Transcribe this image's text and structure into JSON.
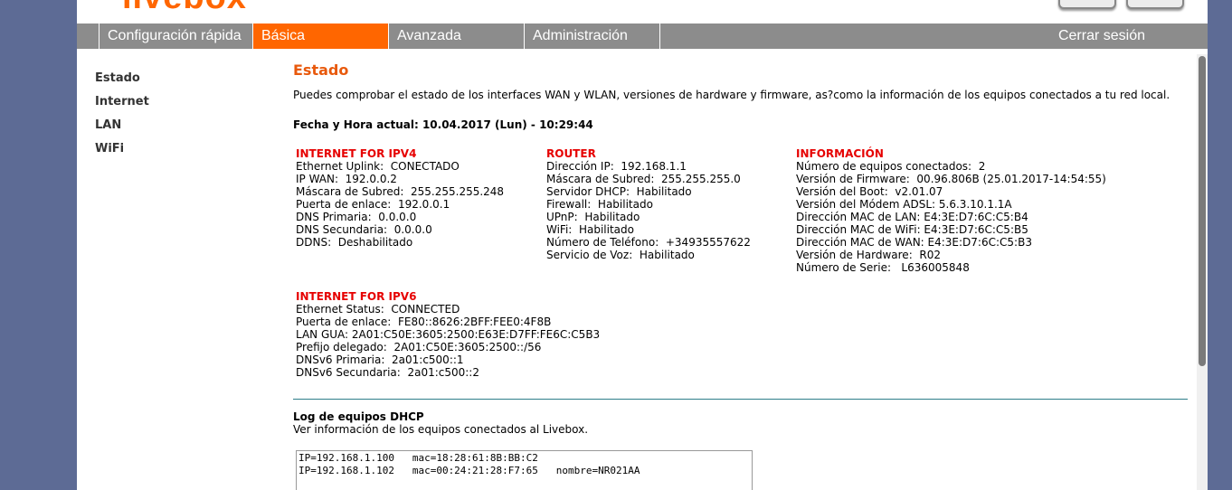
{
  "header": {
    "logo": "livebox"
  },
  "nav": {
    "tabs": [
      {
        "label": "Configuración rápida"
      },
      {
        "label": "Básica"
      },
      {
        "label": "Avanzada"
      },
      {
        "label": "Administración"
      }
    ],
    "active_tab": "Básica",
    "logout_label": "Cerrar sesión"
  },
  "sidebar": {
    "items": [
      {
        "label": "Estado"
      },
      {
        "label": "Internet"
      },
      {
        "label": "LAN"
      },
      {
        "label": "WiFi"
      }
    ]
  },
  "main": {
    "title": "Estado",
    "intro": "Puedes comprobar el estado de los interfaces WAN y WLAN, versiones de hardware y firmware, as?como la información de los equipos conectados a tu red local.",
    "datetime": "Fecha y Hora actual: 10.04.2017 (Lun) - 10:29:44"
  },
  "ipv4": {
    "title": "INTERNET FOR IPV4",
    "rows": [
      "Ethernet Uplink:  CONECTADO",
      "IP WAN:  192.0.0.2",
      "Máscara de Subred:  255.255.255.248",
      "Puerta de enlace:  192.0.0.1",
      "DNS Primaria:  0.0.0.0",
      "DNS Secundaria:  0.0.0.0",
      "DDNS:  Deshabilitado"
    ]
  },
  "router": {
    "title": "ROUTER",
    "rows": [
      "Dirección IP:  192.168.1.1",
      "Máscara de Subred:  255.255.255.0",
      "Servidor DHCP:  Habilitado",
      "Firewall:  Habilitado",
      "UPnP:  Habilitado",
      "WiFi:  Habilitado",
      "Número de Teléfono:  +34935557622",
      "Servicio de Voz:  Habilitado"
    ]
  },
  "info": {
    "title": "INFORMACIÓN",
    "rows": [
      "Número de equipos conectados:  2",
      "Versión de Firmware:  00.96.806B (25.01.2017-14:54:55)",
      "Versión del Boot:  v2.01.07",
      "Versión del Módem ADSL: 5.6.3.10.1.1A",
      "Dirección MAC de LAN: E4:3E:D7:6C:C5:B4",
      "Dirección MAC de WiFi: E4:3E:D7:6C:C5:B5",
      "Dirección MAC de WAN: E4:3E:D7:6C:C5:B3",
      "Versión de Hardware:  R02",
      "Número de Serie:   L636005848"
    ]
  },
  "ipv6": {
    "title": "INTERNET FOR IPV6",
    "rows": [
      "Ethernet Status:  CONNECTED",
      "Puerta de enlace:  FE80::8626:2BFF:FEE0:4F8B",
      "LAN GUA: 2A01:C50E:3605:2500:E63E:D7FF:FE6C:C5B3",
      "Prefijo delegado:  2A01:C50E:3605:2500::/56",
      "DNSv6 Primaria:  2a01:c500::1",
      "DNSv6 Secundaria:  2a01:c500::2"
    ]
  },
  "dhcp_log": {
    "title": "Log de equipos DHCP",
    "subtitle": "Ver información de los equipos conectados al Livebox.",
    "lines": [
      "IP=192.168.1.100   mac=18:28:61:8B:BB:C2",
      "IP=192.168.1.102   mac=00:24:21:28:F7:65   nombre=NR021AA"
    ]
  },
  "colors": {
    "accent": "#ff6600",
    "section_title": "#e60000",
    "nav_bg": "#8c8c8c",
    "divider": "#2f7e8a",
    "desktop_bg": "#5d6b95"
  }
}
